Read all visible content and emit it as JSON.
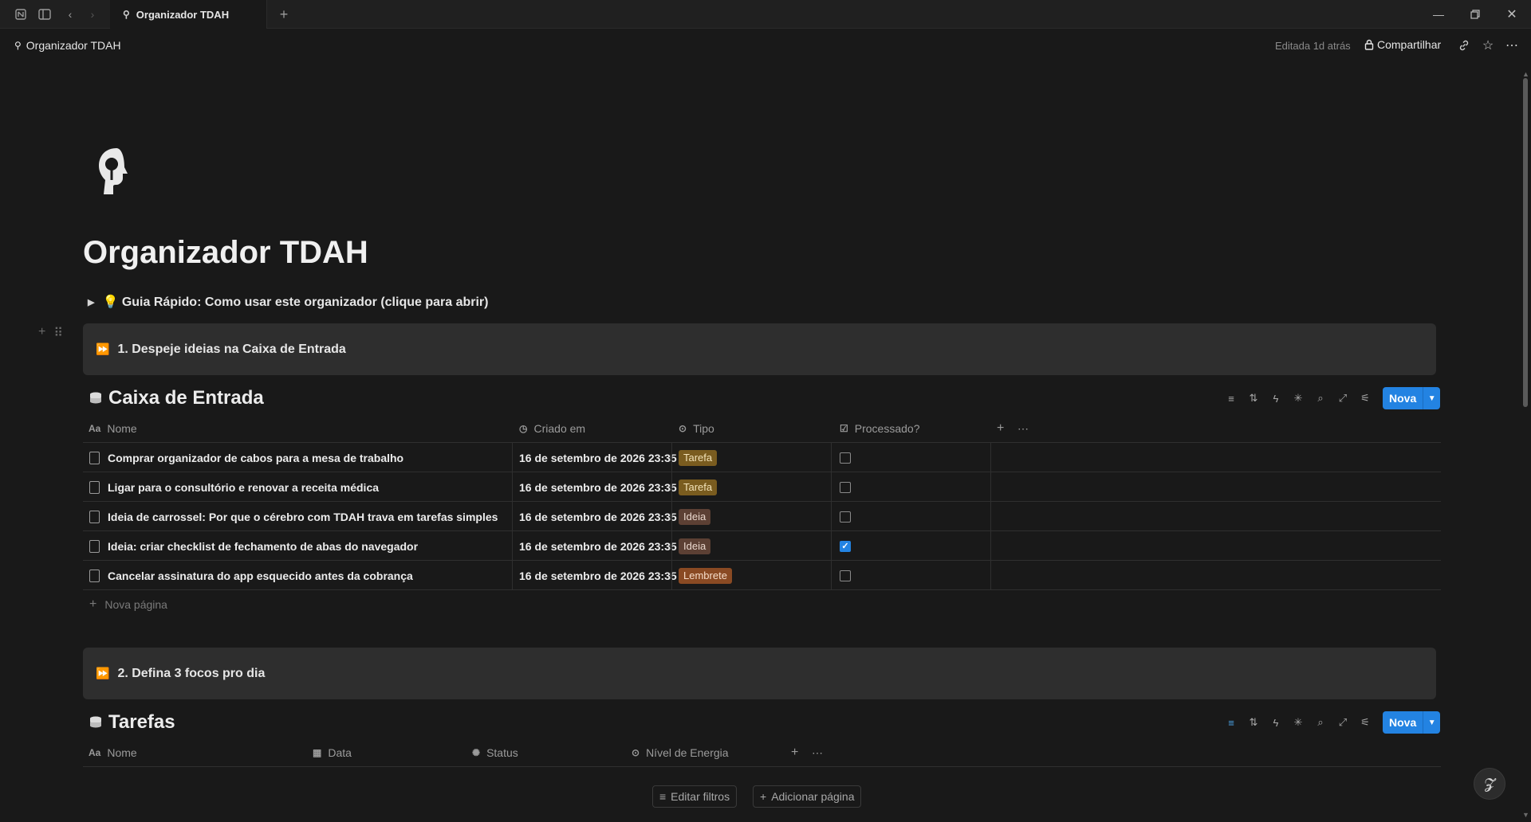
{
  "window": {
    "tab_title": "Organizador TDAH"
  },
  "topbar": {
    "breadcrumb": "Organizador TDAH",
    "edited": "Editada 1d atrás",
    "share_label": "Compartilhar"
  },
  "page": {
    "title": "Organizador TDAH",
    "guide_toggle": "💡 Guia Rápido: Como usar este organizador (clique para abrir)"
  },
  "callouts": {
    "step1": "1. Despeje ideias na Caixa de Entrada",
    "step2": "2. Defina 3 focos pro dia"
  },
  "inbox": {
    "title": "Caixa de Entrada",
    "new_label": "Nova",
    "columns": {
      "name": "Nome",
      "created": "Criado em",
      "type": "Tipo",
      "processed": "Processado?"
    },
    "rows": [
      {
        "name": "Comprar organizador de cabos para a mesa de trabalho",
        "created": "16 de setembro de 2026 23:35",
        "type": "Tarefa",
        "processed": false
      },
      {
        "name": "Ligar para o consultório e renovar a receita médica",
        "created": "16 de setembro de 2026 23:35",
        "type": "Tarefa",
        "processed": false
      },
      {
        "name": "Ideia de carrossel: Por que o cérebro com TDAH trava em tarefas simples",
        "created": "16 de setembro de 2026 23:35",
        "type": "Ideia",
        "processed": false
      },
      {
        "name": "Ideia: criar checklist de fechamento de abas do navegador",
        "created": "16 de setembro de 2026 23:35",
        "type": "Ideia",
        "processed": true
      },
      {
        "name": "Cancelar assinatura do app esquecido antes da cobrança",
        "created": "16 de setembro de 2026 23:35",
        "type": "Lembrete",
        "processed": false
      }
    ],
    "new_page": "Nova página"
  },
  "tasks": {
    "title": "Tarefas",
    "new_label": "Nova",
    "columns": {
      "name": "Nome",
      "date": "Data",
      "status": "Status",
      "energy": "Nível de Energia"
    },
    "edit_filters": "Editar filtros",
    "add_page": "Adicionar página"
  },
  "colors": {
    "accent": "#2383e2",
    "background": "#191919",
    "callout_bg": "#2e2e2e"
  }
}
